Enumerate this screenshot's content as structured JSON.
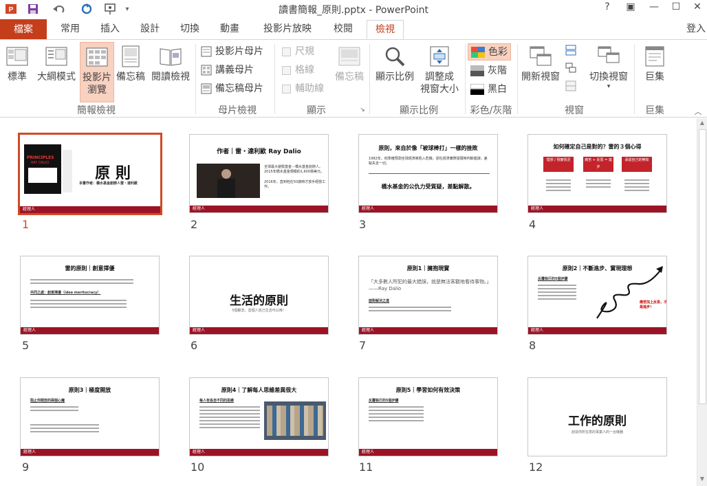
{
  "window": {
    "title": "讀書簡報_原則.pptx - PowerPoint",
    "help": "?",
    "restore_ribbon": "▣",
    "minimize": "—",
    "maximize": "☐",
    "close": "✕"
  },
  "qat": {
    "save": "save-icon",
    "undo": "undo-icon",
    "redo": "redo-icon",
    "present": "slideshow-icon",
    "more": "▾"
  },
  "tabs": [
    {
      "label": "檔案"
    },
    {
      "label": "常用"
    },
    {
      "label": "插入"
    },
    {
      "label": "設計"
    },
    {
      "label": "切換"
    },
    {
      "label": "動畫"
    },
    {
      "label": "投影片放映"
    },
    {
      "label": "校閱"
    },
    {
      "label": "檢視"
    }
  ],
  "login": "登入",
  "ribbon": {
    "normal": "標準",
    "outline": "大綱模式",
    "sorter_line1": "投影片",
    "sorter_line2": "瀏覽",
    "notes": "備忘稿",
    "reading": "閱讀檢視",
    "group_views": "簡報檢視",
    "slide_master": "投影片母片",
    "handout_master": "講義母片",
    "notes_master": "備忘稿母片",
    "group_master": "母片檢視",
    "ruler": "尺規",
    "gridlines": "格線",
    "guides": "輔助線",
    "notes_btn": "備忘稿",
    "group_show": "顯示",
    "zoom": "顯示比例",
    "fit_line1": "調整成",
    "fit_line2": "視窗大小",
    "group_zoom": "顯示比例",
    "color": "色彩",
    "grayscale": "灰階",
    "bw": "黑白",
    "group_color": "彩色/灰階",
    "new_window": "開新視窗",
    "switch_window": "切換視窗",
    "group_window": "視窗",
    "macros": "巨集",
    "group_macros": "巨集"
  },
  "slides": [
    {
      "num": "1",
      "title": "原 則",
      "subtitle": "本書作者：橋水基金創辦人雷・達利歐",
      "book": "PRINCIPLES",
      "book_author": "RAY DALIO",
      "footer": "經理人"
    },
    {
      "num": "2",
      "title": "作者｜雷・達利歐 Ray Dalio",
      "body": "全球最大避險基金－橋水基金創辦人。2015年橋水基金規模約1,600億美元。",
      "body2": "2016年，直到他在50歲時才放手經營工作。",
      "footer": "經理人"
    },
    {
      "num": "3",
      "title": "原則，來自於像「被球棒打」一樣的挫敗",
      "body": "1982年，他準確預測全球經濟將陷入危機，卻在經濟實際發展時判斷錯誤，差點失去一切。",
      "sub": "橋水基金的公仇力受質疑，差點解散。",
      "footer": "經理人"
    },
    {
      "num": "4",
      "title": "如何確定自己是對的？雷的３個心得",
      "a1": "理想 / 現實情況",
      "a2": "痛苦 + 反思 = 進步",
      "a3": "承認自己的無知",
      "footer": "經理人"
    },
    {
      "num": "5",
      "title": "雷的原則｜創意擇優",
      "body": "共同之處：創意擇優（idea meritocracy）",
      "footer": "經理人"
    },
    {
      "num": "6",
      "title": "生活的原則",
      "sub": "5個觀念，並個人自己生活可以用！",
      "footer": "經理人"
    },
    {
      "num": "7",
      "title": "原則1｜擁抱現實",
      "quote": "「大多數人所犯的最大錯誤，就是無法客觀地看待事物。」——Ray Dalio",
      "body": "面對解決之道",
      "footer": "經理人"
    },
    {
      "num": "8",
      "title": "原則2｜不斷進步、實現理想",
      "body": "反覆執行的5個步驟",
      "red": "痛苦加上反思，才是進步！",
      "footer": "經理人"
    },
    {
      "num": "9",
      "title": "原則3｜極度開放",
      "body": "阻止你開放的兩個心魔",
      "footer": "經理人"
    },
    {
      "num": "10",
      "title": "原則4｜了解每人思維差異很大",
      "body": "每人有各自不同的思維",
      "footer": "經理人"
    },
    {
      "num": "11",
      "title": "原則5｜學習如何有效決策",
      "body": "反覆執行的5個步驟",
      "footer": "經理人"
    },
    {
      "num": "12",
      "title": "工作的原則",
      "sub": "創造你所在意的事業人的一台機器",
      "footer": ""
    }
  ]
}
